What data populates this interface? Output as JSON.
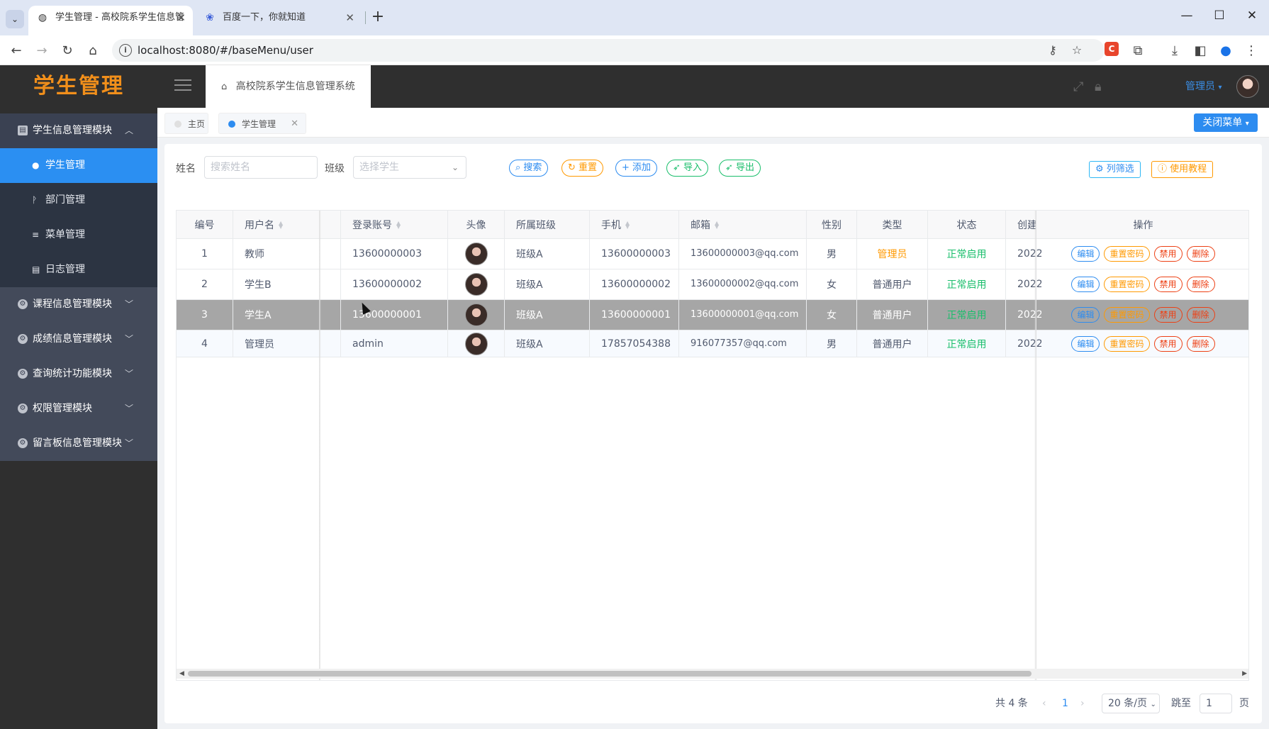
{
  "browser": {
    "tabs": [
      {
        "title": "学生管理 - 高校院系学生信息管",
        "favicon": "globe-icon"
      },
      {
        "title": "百度一下，你就知道",
        "favicon": "paw-icon"
      }
    ],
    "url": "localhost:8080/#/baseMenu/user"
  },
  "header": {
    "logo": "学生管理",
    "system_title": "高校院系学生信息管理系统",
    "user": "管理员"
  },
  "sidebar": {
    "groups": [
      {
        "label": "学生信息管理模块",
        "open": true
      },
      {
        "label": "课程信息管理模块"
      },
      {
        "label": "成绩信息管理模块"
      },
      {
        "label": "查询统计功能模块"
      },
      {
        "label": "权限管理模块"
      },
      {
        "label": "留言板信息管理模块"
      }
    ],
    "items": [
      {
        "label": "学生管理",
        "active": true
      },
      {
        "label": "部门管理"
      },
      {
        "label": "菜单管理"
      },
      {
        "label": "日志管理"
      }
    ]
  },
  "tags": {
    "home": "主页",
    "current": "学生管理",
    "close_menu": "关闭菜单"
  },
  "filters": {
    "name_label": "姓名",
    "name_placeholder": "搜索姓名",
    "class_label": "班级",
    "class_placeholder": "选择学生",
    "search": "搜索",
    "reset": "重置",
    "add": "添加",
    "import": "导入",
    "export": "导出",
    "column_filter": "列筛选",
    "tutorial": "使用教程"
  },
  "table": {
    "headers": {
      "id": "编号",
      "username": "用户名",
      "account": "登录账号",
      "avatar": "头像",
      "class": "所属班级",
      "phone": "手机",
      "email": "邮箱",
      "gender": "性别",
      "type": "类型",
      "status": "状态",
      "created": "创建",
      "actions": "操作"
    },
    "rows": [
      {
        "id": "1",
        "username": "教师",
        "account": "13600000003",
        "class": "班级A",
        "phone": "13600000003",
        "email": "13600000003@qq.com",
        "gender": "男",
        "type": "管理员",
        "status": "正常启用",
        "created": "2022"
      },
      {
        "id": "2",
        "username": "学生B",
        "account": "13600000002",
        "class": "班级A",
        "phone": "13600000002",
        "email": "13600000002@qq.com",
        "gender": "女",
        "type": "普通用户",
        "status": "正常启用",
        "created": "2022"
      },
      {
        "id": "3",
        "username": "学生A",
        "account": "13600000001",
        "class": "班级A",
        "phone": "13600000001",
        "email": "13600000001@qq.com",
        "gender": "女",
        "type": "普通用户",
        "status": "正常启用",
        "created": "2022"
      },
      {
        "id": "4",
        "username": "管理员",
        "account": "admin",
        "class": "班级A",
        "phone": "17857054388",
        "email": "916077357@qq.com",
        "gender": "男",
        "type": "普通用户",
        "status": "正常启用",
        "created": "2022"
      }
    ],
    "actions": {
      "edit": "编辑",
      "reset_pwd": "重置密码",
      "disable": "禁用",
      "delete": "删除"
    }
  },
  "pagination": {
    "total": "共 4 条",
    "page": "1",
    "page_size": "20 条/页",
    "jump_label": "跳至",
    "jump_value": "1",
    "page_suffix": "页"
  },
  "colors": {
    "accent": "#2d8cf0",
    "logo": "#f18f1b",
    "warning": "#ff9900",
    "success": "#19be6b",
    "danger": "#ed4014"
  }
}
